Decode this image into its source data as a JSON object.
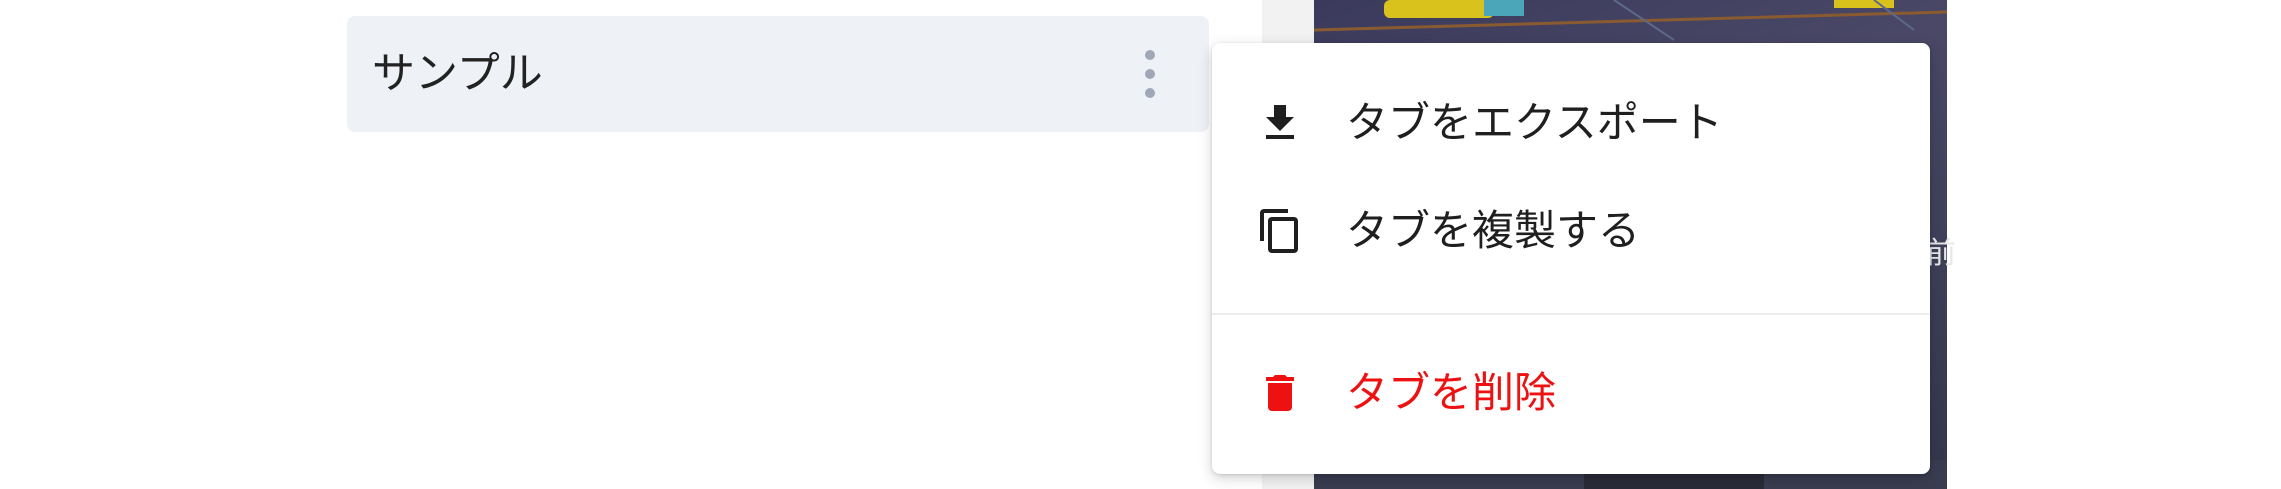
{
  "tab": {
    "label": "サンプル",
    "more_icon": "more-vert-icon"
  },
  "context_menu": {
    "items": [
      {
        "label": "タブをエクスポート",
        "icon": "download-icon",
        "color": "#1f1f1f"
      },
      {
        "label": "タブを複製する",
        "icon": "copy-icon",
        "color": "#1f1f1f"
      },
      {
        "label": "タブを削除",
        "icon": "trash-icon",
        "color": "#ee1111"
      }
    ]
  },
  "colors": {
    "tab_background": "#eef1f5",
    "danger": "#ee1111",
    "kebab": "#a0a8b8"
  }
}
